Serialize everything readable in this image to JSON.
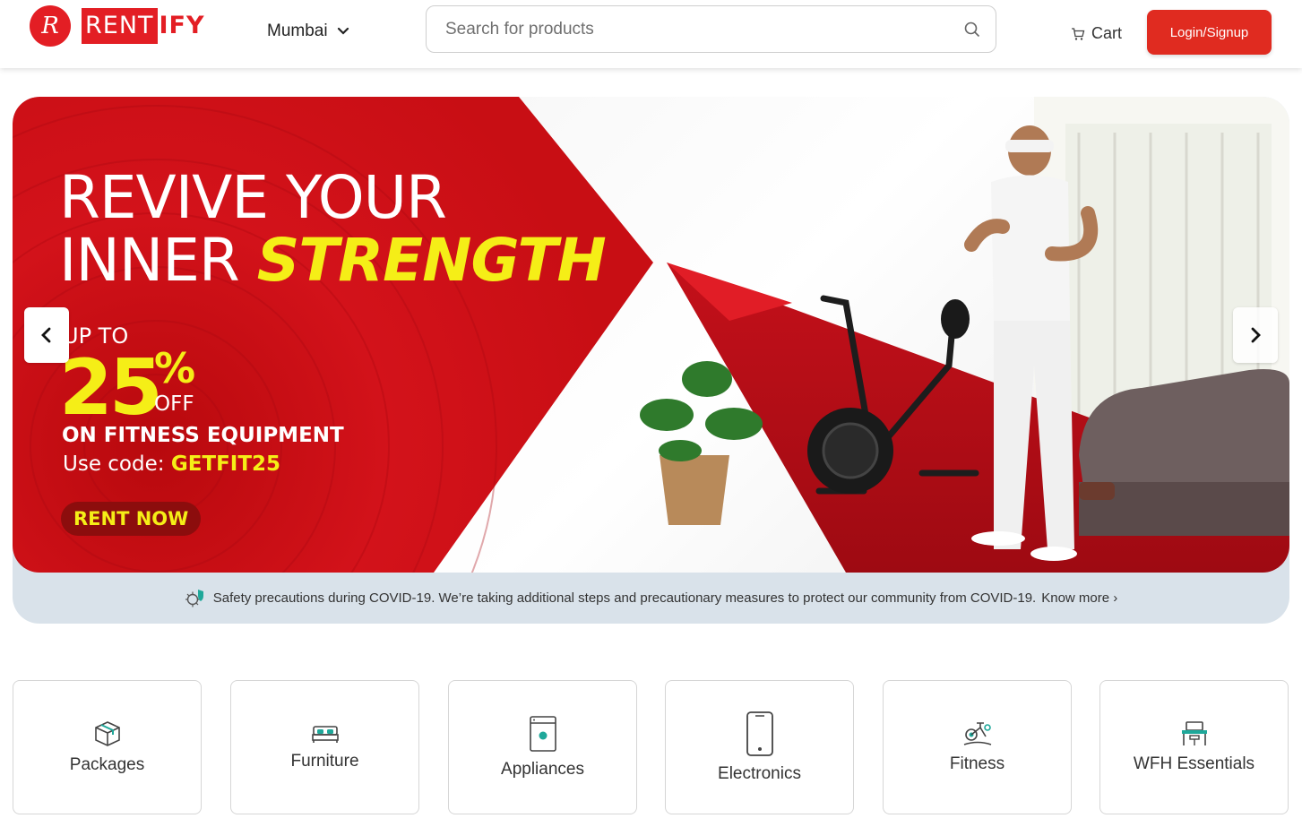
{
  "header": {
    "logo_letter": "R",
    "logo_rent": "RENT",
    "logo_ify": "IFY",
    "city": "Mumbai",
    "search_placeholder": "Search for products",
    "cart_label": "Cart",
    "login_label": "Login/Signup"
  },
  "banner": {
    "headline_line1": "REVIVE YOUR",
    "headline_line2_plain": "INNER ",
    "headline_line2_highlight": "STRENGTH",
    "up_to": "UP TO",
    "discount": "25",
    "percent": "%",
    "off": "OFF",
    "category": "ON FITNESS EQUIPMENT",
    "code_label": "Use code: ",
    "code": "GETFIT25",
    "cta": "RENT NOW"
  },
  "notice": {
    "text": "Safety precautions during COVID-19. We’re taking additional steps and precautionary measures to protect our community from COVID-19.",
    "link": "Know more ›"
  },
  "categories": [
    {
      "label": "Packages",
      "icon": "package-icon"
    },
    {
      "label": "Furniture",
      "icon": "bed-icon"
    },
    {
      "label": "Appliances",
      "icon": "washing-machine-icon"
    },
    {
      "label": "Electronics",
      "icon": "smartphone-icon"
    },
    {
      "label": "Fitness",
      "icon": "exercise-bike-icon"
    },
    {
      "label": "WFH Essentials",
      "icon": "desk-chair-icon"
    }
  ],
  "colors": {
    "brand_red": "#e31e24",
    "button_red": "#e02b20",
    "highlight_yellow": "#f5ee17",
    "accent_teal": "#1fa89a"
  }
}
